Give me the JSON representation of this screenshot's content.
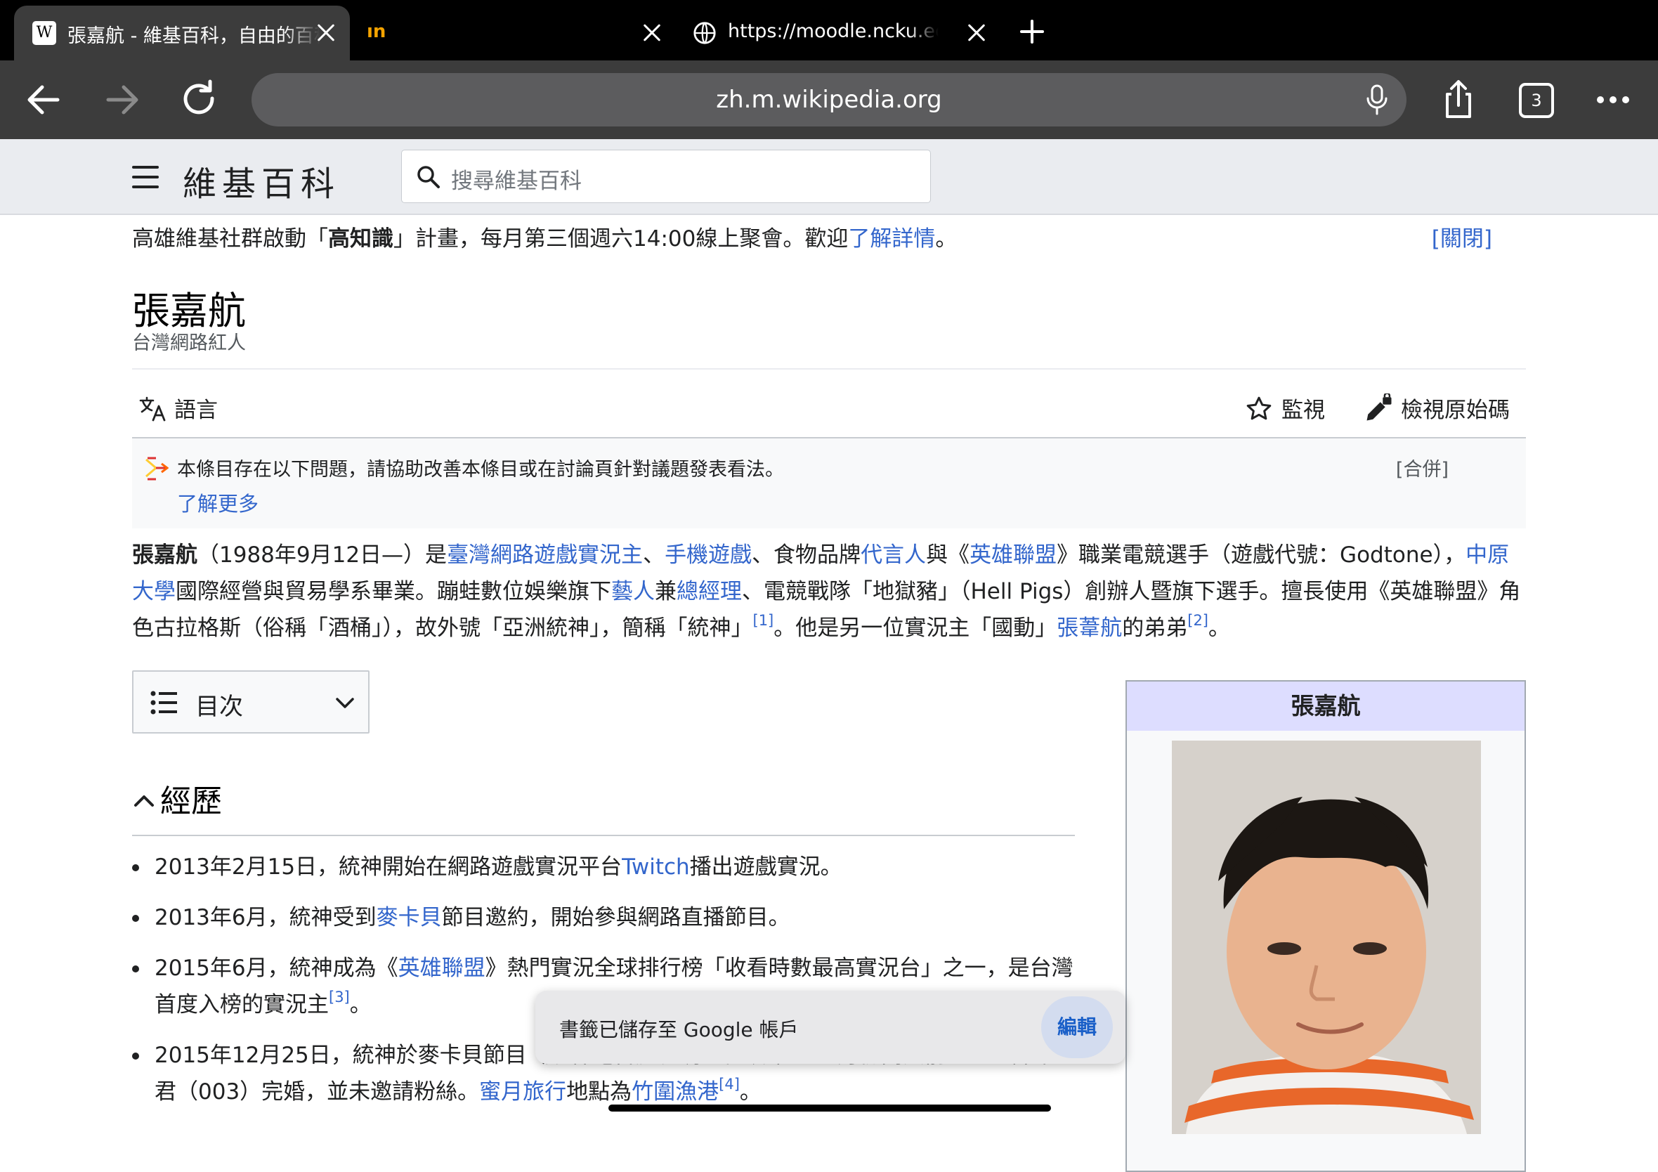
{
  "browser": {
    "tabs": [
      {
        "favicon_text": "W",
        "title": "張嘉航 - 維基百科，自由的百科全書",
        "active": true
      },
      {
        "favicon_text": "ın",
        "title": "",
        "active": false
      },
      {
        "favicon_text": "",
        "title": "https://moodle.ncku.edu.tw",
        "active": false
      }
    ],
    "url": "zh.m.wikipedia.org",
    "tab_count": "3"
  },
  "wiki": {
    "logo": "維基百科",
    "search_placeholder": "搜尋維基百科"
  },
  "notice": {
    "pre": "高雄維基社群啟動「",
    "bold": "高知識",
    "post": "」計畫，每月第三個週六14:00線上聚會。歡迎",
    "link": "了解詳情",
    "end": "。",
    "close": "[關閉]"
  },
  "article": {
    "title": "張嘉航",
    "subtitle": "台灣網路紅人",
    "language": "語言",
    "watch": "監視",
    "view_source": "檢視原始碼",
    "issue_text": "本條目存在以下問題，請協助改善本條目或在討論頁針對議題發表看法。",
    "issue_more": "了解更多",
    "issue_merge": "[合併]",
    "toc_label": "目次",
    "section_title": "經歷",
    "infobox_title": "張嘉航"
  },
  "lead": {
    "t1": "張嘉航",
    "t2": "（1988年9月12日—）是",
    "l1": "臺灣網路遊戲實況主",
    "t3": "、",
    "l2": "手機遊戲",
    "t4": "、食物品牌",
    "l3": "代言人",
    "t5": "與《",
    "l4": "英雄聯盟",
    "t6": "》職業電競選手（遊戲代號：Godtone），",
    "l5": "中原大學",
    "t7": "國際經營與貿易學系畢業。蹦蛙數位娛樂旗下",
    "l6": "藝人",
    "t8": "兼",
    "l7": "總經理",
    "t9": "、電競戰隊「地獄豬」（Hell Pigs）創辦人暨旗下選手。擅長使用《英雄聯盟》角色古拉格斯（俗稱「酒桶」），故外號「亞洲統神」，簡稱「統神」",
    "r1": "[1]",
    "t10": "。他是另一位實況主「國動」",
    "l8": "張葦航",
    "t11": "的弟弟",
    "r2": "[2]",
    "t12": "。"
  },
  "history": [
    {
      "a": "2013年2月15日，統神開始在網路遊戲實況平台",
      "link": "Twitch",
      "b": "播出遊戲實況。",
      "ref": ""
    },
    {
      "a": "2013年6月，統神受到",
      "link": "麥卡貝",
      "b": "節目邀約，開始參與網路直播節目。",
      "ref": ""
    },
    {
      "a": "2015年6月，統神成為《",
      "link": "英雄聯盟",
      "b": "》熱門實況全球排行榜「收看時數最高實況台」之一，是台灣首度入榜的實況主",
      "ref": "[3]",
      "c": "。"
    },
    {
      "a": "2015年12月25日，統神於麥卡貝節目《統神電台》表明已在該年8至9月份間與前",
      "link": "經紀人",
      "b": "陳卓君（003）完婚，並未邀請粉絲。",
      "link2": "蜜月旅行",
      "b2": "地點為",
      "link3": "竹圍漁港",
      "ref": "[4]",
      "c": "。"
    }
  ],
  "snackbar": {
    "message": "書籤已儲存至 Google 帳戶",
    "action": "編輯"
  }
}
